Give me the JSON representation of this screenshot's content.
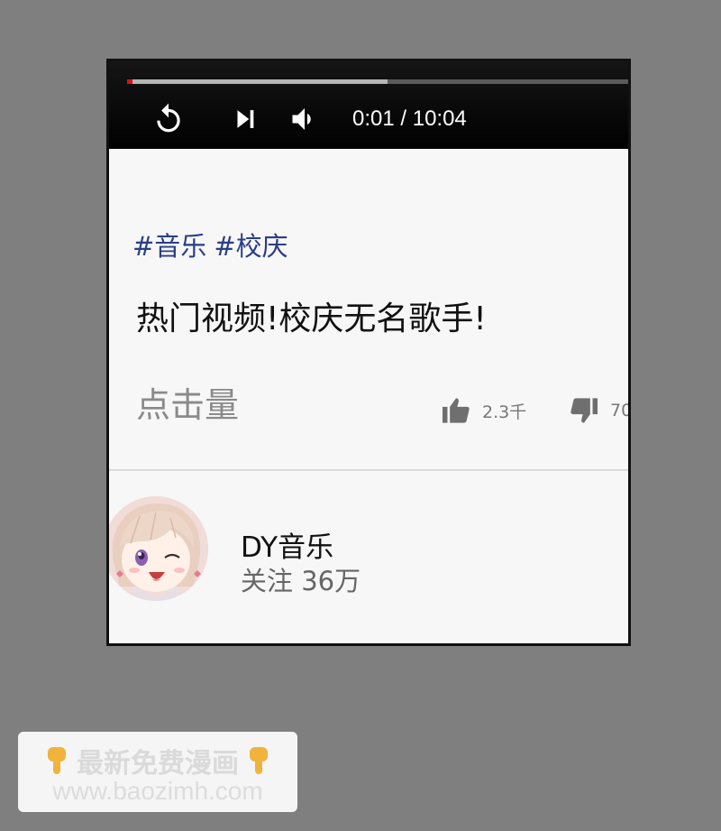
{
  "player": {
    "progress": 0.005,
    "buffered": 0.52,
    "time_display": "0:01 / 10:04",
    "icons": [
      "replay-icon",
      "skip-next-icon",
      "volume-icon"
    ]
  },
  "video": {
    "tags": [
      "#音乐",
      "#校庆"
    ],
    "title": "热门视频!校庆无名歌手!",
    "views_label": "点击量",
    "likes": "2.3千",
    "dislikes": "70"
  },
  "channel": {
    "name": "DY音乐",
    "subscribers": "关注 36万"
  },
  "watermark": {
    "line1": "最新免费漫画",
    "line2": "www.baozimh.com"
  },
  "colors": {
    "background": "#7f7f7f",
    "player_bar": "#000000",
    "progress_played": "#e01010",
    "tag_link": "#2a3d85",
    "panel": "#f7f7f7"
  }
}
